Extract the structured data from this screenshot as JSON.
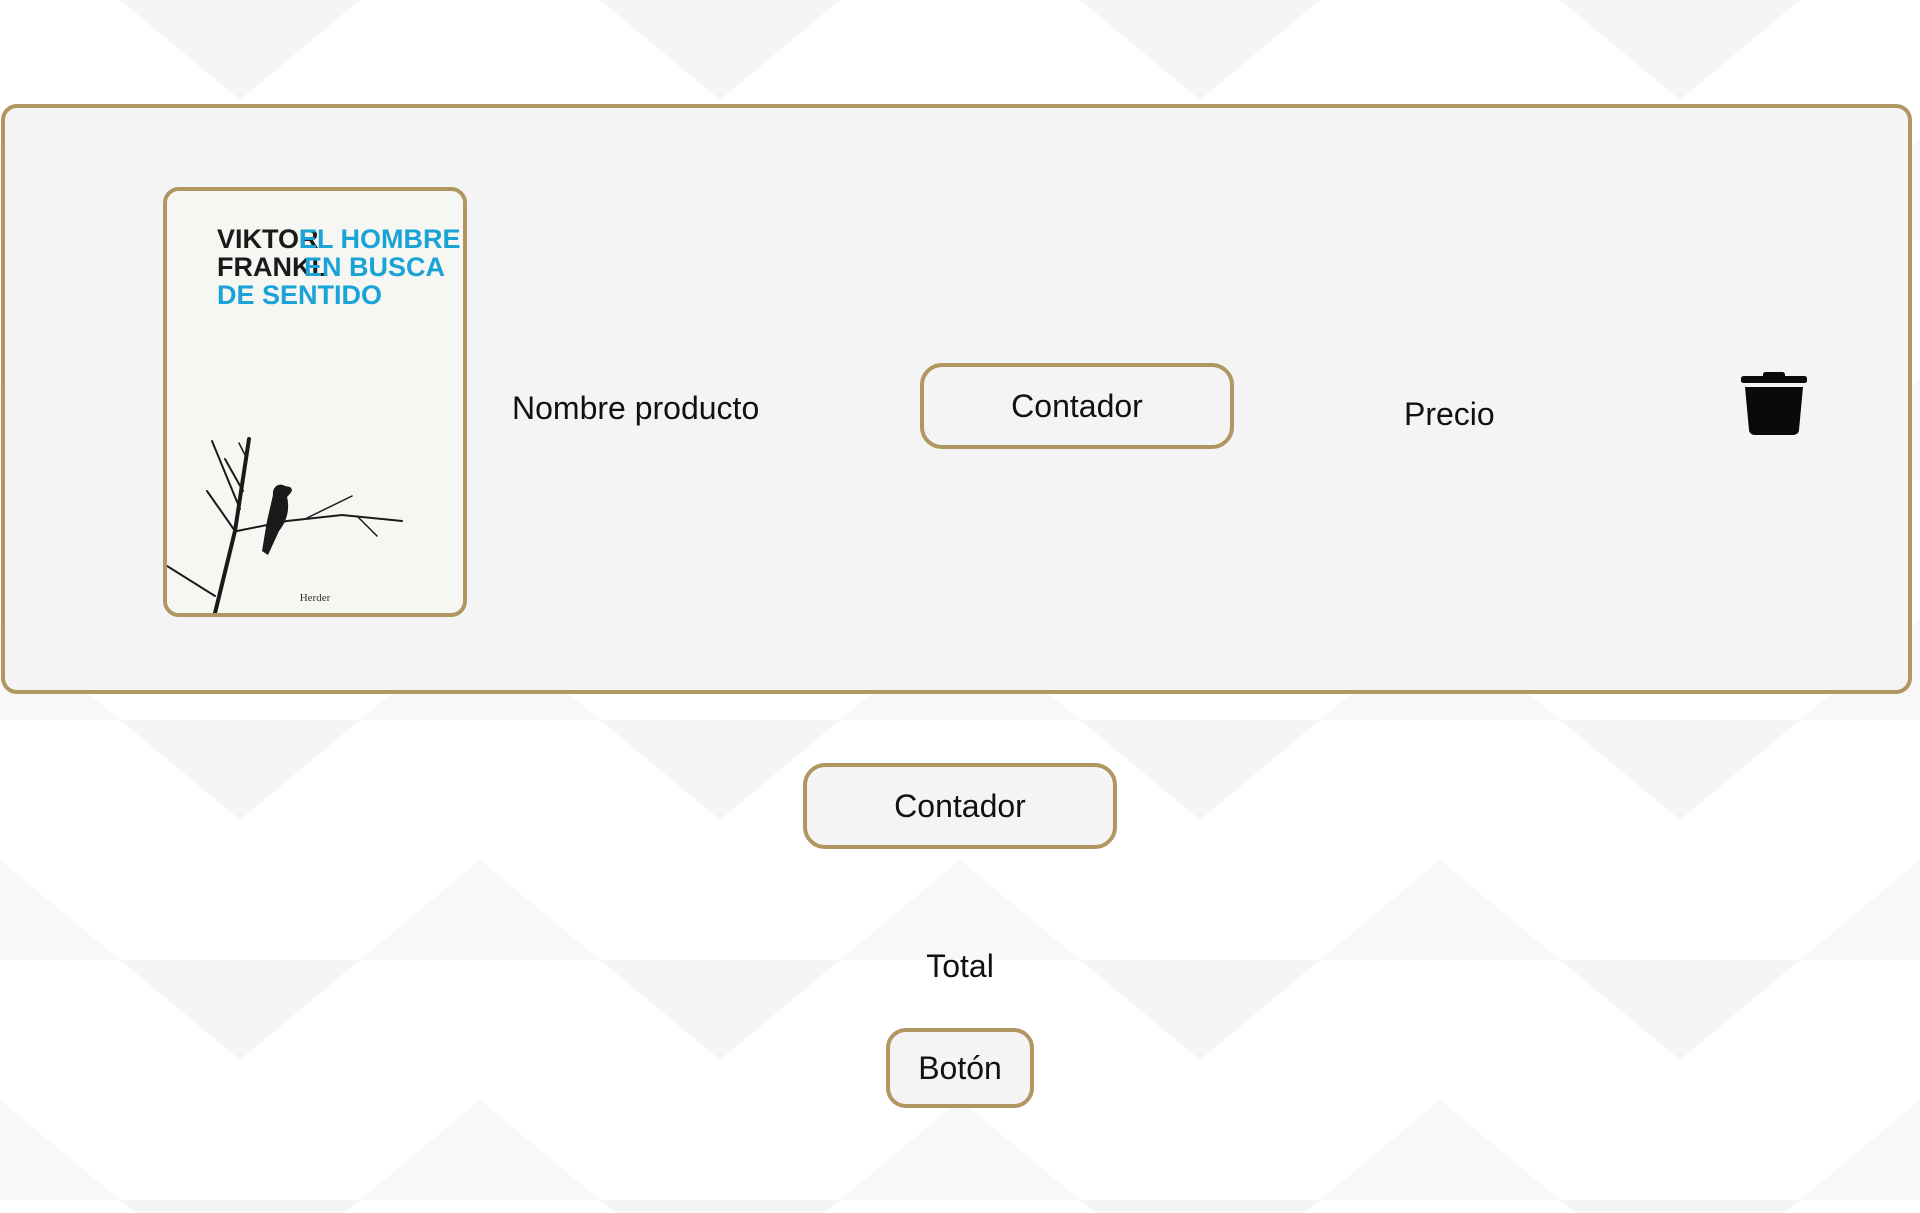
{
  "colors": {
    "accent_border": "#b09660",
    "card_background": "#f4f4f4",
    "page_background": "#ffffff",
    "cover_title_dark": "#1a1a1a",
    "cover_title_blue": "#1aa3d6"
  },
  "cart_item": {
    "book_cover": {
      "author_line1": "VIKTOR",
      "author_line2": "FRANKL",
      "title_line1": "EL HOMBRE",
      "title_line2": "EN BUSCA",
      "title_line3": "DE SENTIDO",
      "publisher": "Herder"
    },
    "product_name": "Nombre producto",
    "counter_label": "Contador",
    "price_label": "Precio",
    "delete_icon": "trash-icon"
  },
  "summary": {
    "counter_label": "Contador",
    "total_label": "Total",
    "button_label": "Botón"
  }
}
